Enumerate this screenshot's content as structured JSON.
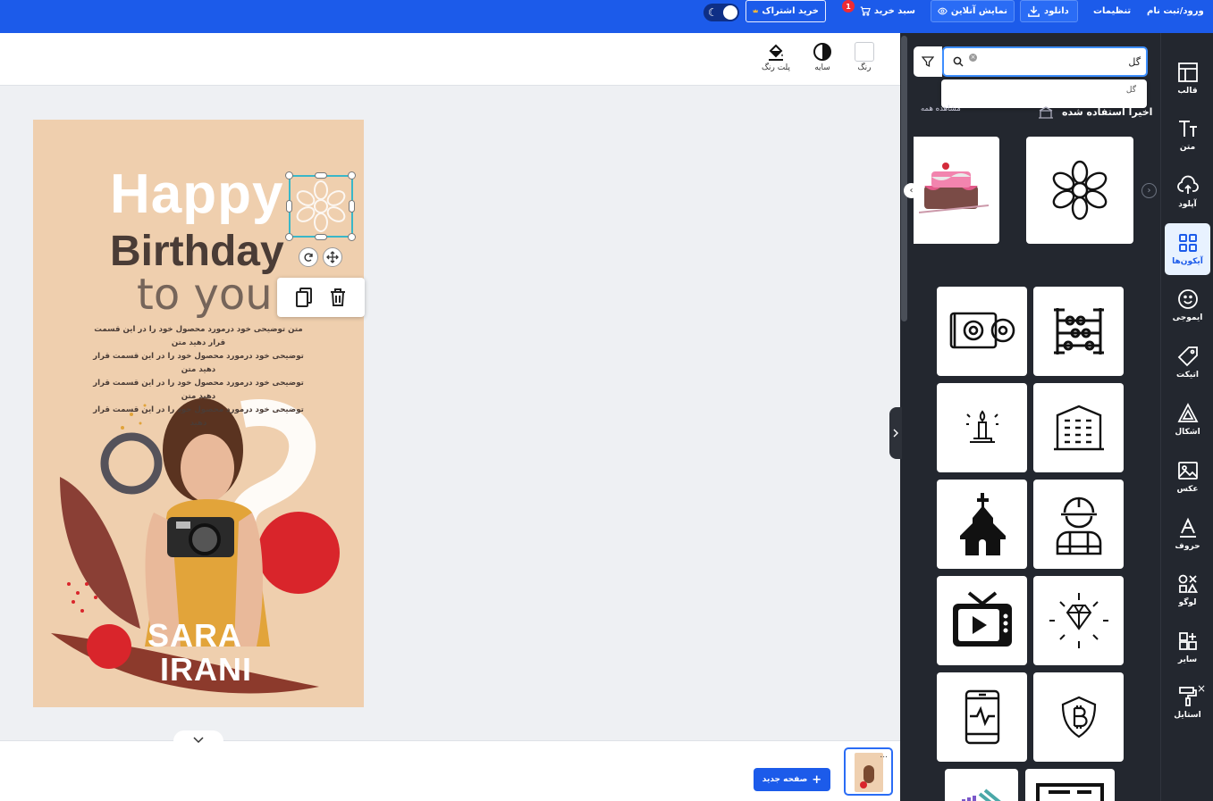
{
  "topbar": {
    "login": "ورود/ثبت نام",
    "settings": "تنظیمات",
    "download": "دانلود",
    "online_view": "نمایش آنلاین",
    "cart": "سبد خرید",
    "cart_count": "1",
    "subscribe": "خرید اشتراک"
  },
  "toolbar": {
    "color": "رنگ",
    "shadow": "سایه",
    "palette": "پلت رنگ"
  },
  "poster": {
    "happy": "Happy",
    "birthday": "Birthday",
    "to_you": "to you",
    "desc_1": "متن توضیحی خود درمورد محصول خود را در این قسمت قرار دهید متن",
    "desc_2": "توضیحی خود درمورد محصول خود را در این قسمت قرار دهید متن",
    "desc_3": "توضیحی خود درمورد محصول خود را در این قسمت قرار دهید متن",
    "desc_4": "توضیحی خود درمورد محصول خود را در این قسمت قرار دهید",
    "name_1": "SARA",
    "name_2": "IRANI"
  },
  "footer": {
    "new_page": "صفحه جدید",
    "page_menu": "..."
  },
  "panel": {
    "search_value": "گل",
    "suggestion": "گل",
    "recent_title": "اخیرا استفاده شده",
    "see_all": "مشاهده همه",
    "icons": [
      "dvd-player-icon",
      "abacus-icon",
      "candle-icon",
      "building-icon",
      "church-icon",
      "engineer-icon",
      "tv-play-icon",
      "diamond-icon",
      "phone-health-icon",
      "bitcoin-shield-icon"
    ]
  },
  "sidenav": [
    {
      "label": "قالب",
      "icon": "template-icon"
    },
    {
      "label": "متن",
      "icon": "text-icon"
    },
    {
      "label": "آپلود",
      "icon": "upload-icon"
    },
    {
      "label": "آیکون‌ها",
      "icon": "icons-grid-icon"
    },
    {
      "label": "ایموجی",
      "icon": "emoji-icon"
    },
    {
      "label": "اتیکت",
      "icon": "tag-icon"
    },
    {
      "label": "اشکال",
      "icon": "shapes-icon"
    },
    {
      "label": "عکس",
      "icon": "image-icon"
    },
    {
      "label": "حروف",
      "icon": "letter-icon"
    },
    {
      "label": "لوگو",
      "icon": "logo-icon"
    },
    {
      "label": "سایر",
      "icon": "more-icon"
    },
    {
      "label": "استایل",
      "icon": "style-icon"
    }
  ],
  "colors": {
    "brand": "#1c5bea",
    "panel": "#23272f",
    "accent": "#3ab7c8",
    "poster_bg": "#efcfae"
  }
}
